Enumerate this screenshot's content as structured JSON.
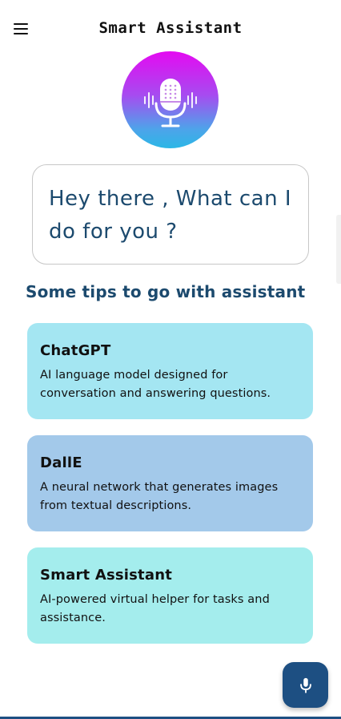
{
  "appbar": {
    "title": "Smart Assistant",
    "menu_icon": "menu-icon"
  },
  "avatar": {
    "icon": "microphone-icon",
    "gradient": [
      "#e40af1",
      "#a74bf0",
      "#4ea3ea",
      "#2bb7e6"
    ]
  },
  "greeting": {
    "text": "Hey there , What can I do for you ?"
  },
  "tips": {
    "heading": "Some tips to go with assistant",
    "cards": [
      {
        "title": "ChatGPT",
        "description": "AI language model designed for conversation and answering questions.",
        "color": "#a4e6f2"
      },
      {
        "title": "DallE",
        "description": "A neural network that generates images from textual descriptions.",
        "color": "#a3c9ea"
      },
      {
        "title": "Smart Assistant",
        "description": "AI-powered virtual helper for tasks and assistance.",
        "color": "#a4eded"
      }
    ]
  },
  "fab": {
    "icon": "microphone-icon",
    "color": "#1d4f82"
  },
  "colors": {
    "heading_text": "#1c4a6e",
    "primary": "#1d4f82"
  }
}
